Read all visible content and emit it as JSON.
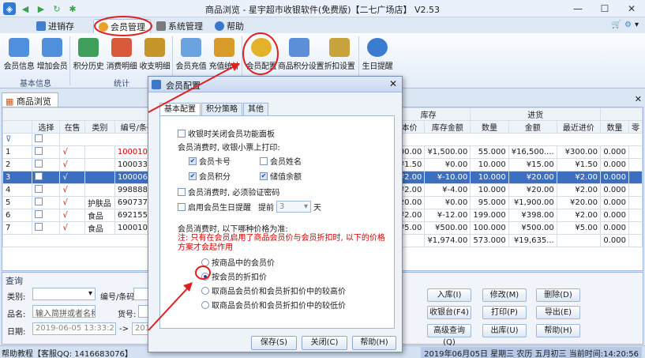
{
  "window": {
    "title": "商品浏览 - 星宇超市收银软件(免费版)【二七广场店】 V2.53",
    "controls": [
      "—",
      "☐",
      "✕"
    ]
  },
  "ribbon": {
    "tabs": [
      {
        "label": "进销存",
        "icon": "cart-icon",
        "color": "#3f7fd0"
      },
      {
        "label": "会员管理",
        "icon": "member-icon",
        "color": "#e9a12a"
      },
      {
        "label": "系统管理",
        "icon": "settings-icon",
        "color": "#7a7a7a"
      },
      {
        "label": "帮助",
        "icon": "help-icon",
        "color": "#3b78c8"
      }
    ],
    "active_tab": "会员管理",
    "buttons": [
      {
        "label": "会员信息",
        "icon": "members-icon",
        "color": "#4f8fdc"
      },
      {
        "label": "增加会员",
        "icon": "add-member-icon",
        "color": "#4f8fdc"
      },
      {
        "label": "积分历史",
        "icon": "points-history-icon",
        "color": "#3d9f5a"
      },
      {
        "label": "消费明细",
        "icon": "consume-detail-icon",
        "color": "#d85a3a"
      },
      {
        "label": "收支明细",
        "icon": "income-detail-icon",
        "color": "#c7962a"
      },
      {
        "label": "会员充值",
        "icon": "recharge-icon",
        "color": "#6aa3e0"
      },
      {
        "label": "充值统计",
        "icon": "recharge-stats-icon",
        "color": "#d99b2a"
      },
      {
        "label": "会员配置",
        "icon": "gear-icon",
        "color": "#e3b22a"
      },
      {
        "label": "商品积分设置",
        "icon": "points-setting-icon",
        "color": "#5d8fd8"
      },
      {
        "label": "折扣设置",
        "icon": "discount-icon",
        "color": "#c8a23a"
      },
      {
        "label": "生日提醒",
        "icon": "alarm-clock-icon",
        "color": "#3a7dd0"
      }
    ],
    "groups": [
      "基本信息",
      "统计"
    ]
  },
  "document": {
    "tab_label": "商品浏览",
    "group_headers": {
      "stock": "库存",
      "purchase": "进货"
    },
    "columns": [
      "",
      "选择",
      "在售",
      "类别",
      "编号/条码",
      "成本价",
      "库存金额",
      "数量",
      "金额",
      "最近进价",
      "数量",
      "零"
    ],
    "rows": [
      {
        "n": "1",
        "sale": "√",
        "cat": "",
        "code": "10001001",
        "cost": "¥300.00",
        "stockamt": "¥1,500.00",
        "qty": "55.000",
        "amt": "¥16,500....",
        "last": "¥300.00",
        "qty2": "0.000",
        "red": true
      },
      {
        "n": "2",
        "sale": "√",
        "cat": "",
        "code": "1000331",
        "cost": "¥1.50",
        "stockamt": "¥0.00",
        "qty": "10.000",
        "amt": "¥15.00",
        "last": "¥1.50",
        "qty2": "0.000",
        "red": false
      },
      {
        "n": "3",
        "sale": "√",
        "cat": "",
        "code": "1000067",
        "cost": "¥2.00",
        "stockamt": "¥-10.00",
        "qty": "10.000",
        "amt": "¥20.00",
        "last": "¥2.00",
        "qty2": "0.000",
        "red": false,
        "selected": true
      },
      {
        "n": "4",
        "sale": "√",
        "cat": "",
        "code": "9988888",
        "cost": "¥2.00",
        "stockamt": "¥-4.00",
        "qty": "10.000",
        "amt": "¥20.00",
        "last": "¥2.00",
        "qty2": "0.000",
        "red": false
      },
      {
        "n": "5",
        "sale": "√",
        "cat": "护肤品",
        "code": "69073765",
        "cost": "¥20.00",
        "stockamt": "¥0.00",
        "qty": "95.000",
        "amt": "¥1,900.00",
        "last": "¥20.00",
        "qty2": "0.000",
        "red": false
      },
      {
        "n": "6",
        "sale": "√",
        "cat": "食品",
        "code": "69215555",
        "cost": "¥2.00",
        "stockamt": "¥-12.00",
        "qty": "199.000",
        "amt": "¥398.00",
        "last": "¥2.00",
        "qty2": "0.000",
        "red": false
      },
      {
        "n": "7",
        "sale": "√",
        "cat": "食品",
        "code": "10001004",
        "cost": "¥5.00",
        "stockamt": "¥500.00",
        "qty": "100.000",
        "amt": "¥500.00",
        "last": "¥5.00",
        "qty2": "0.000",
        "red": false
      }
    ],
    "totals": {
      "stockamt": "¥1,974.00",
      "qty": "573.000",
      "amt": "¥19,635...",
      "qty2": "0.000"
    }
  },
  "query": {
    "title": "查询",
    "category_label": "类别:",
    "code_label": "编号/条码:",
    "name_label": "品名:",
    "name_placeholder": "输入简拼或者名称",
    "shelf_label": "货号:",
    "date_label": "日期:",
    "date_from": "2019-06-05 13:33:27",
    "date_to": "2019-",
    "buttons": [
      "入库(I)",
      "修改(M)",
      "删除(D)",
      "收银台(F4)",
      "打印(P)",
      "导出(E)",
      "高级查询(Q)",
      "出库(U)",
      "帮助(H)"
    ]
  },
  "status": {
    "left": "帮助教程【客服QQ: 1416683076】",
    "right": "2019年06月05日 星期三 农历 五月初三 当前时间:14:20:56"
  },
  "dialog": {
    "title": "会员配置",
    "tabs": [
      "基本配置",
      "积分策略",
      "其他"
    ],
    "close_on_receipt": "收银时关闭会员功能面板",
    "print_label": "会员消费时, 收银小票上打印:",
    "print_options": [
      {
        "label": "会员卡号",
        "checked": true
      },
      {
        "label": "会员姓名",
        "checked": false
      },
      {
        "label": "会员积分",
        "checked": true
      },
      {
        "label": "储值余额",
        "checked": true
      }
    ],
    "verify_password": "会员消费时, 必须验证密码",
    "birthday_reminder": "启用会员生日提醒",
    "advance_label": "提前",
    "advance_value": "3",
    "day_unit": "天",
    "price_rule_label": "会员消费时, 以下哪种价格为准:",
    "warning": "注: 只有在会员启用了商品会员价与会员折扣时, 以下的价格方案才会起作用",
    "price_options": [
      {
        "label": "按商品中的会员价",
        "selected": false
      },
      {
        "label": "按会员的折扣价",
        "selected": true
      },
      {
        "label": "取商品会员价和会员折扣价中的较高价",
        "selected": false
      },
      {
        "label": "取商品会员价和会员折扣价中的较低价",
        "selected": false
      }
    ],
    "save": "保存(S)",
    "close": "关闭(C)",
    "help": "帮助(H)"
  }
}
